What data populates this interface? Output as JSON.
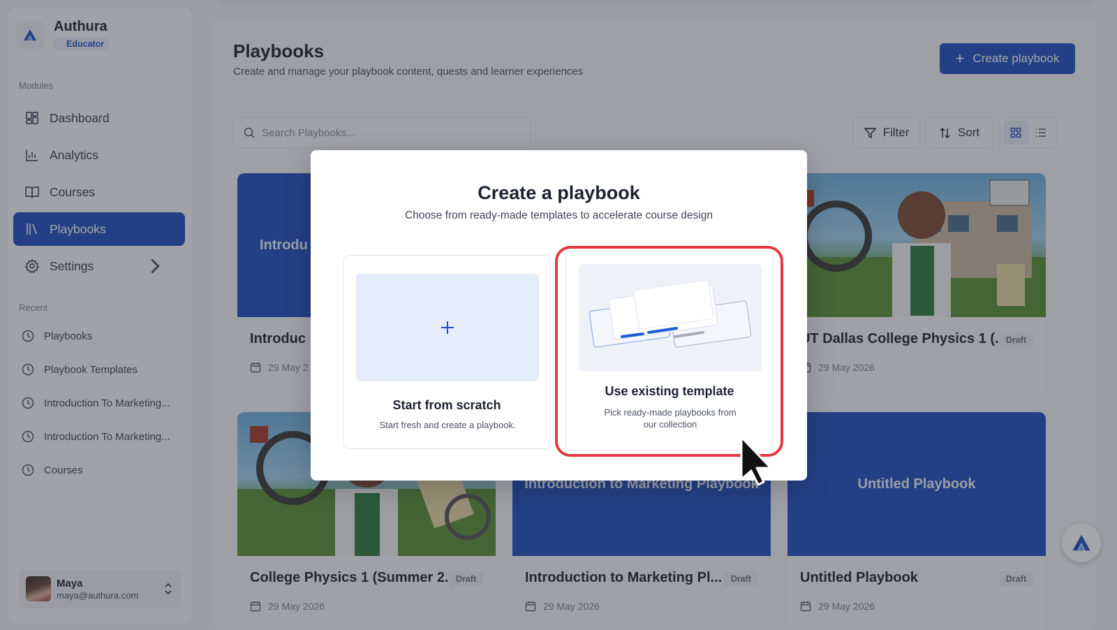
{
  "brand": {
    "name": "Authura",
    "role": "Educator"
  },
  "sidebar": {
    "modules_label": "Modules",
    "items": [
      {
        "label": "Dashboard",
        "icon": "dashboard-icon"
      },
      {
        "label": "Analytics",
        "icon": "bar-chart-icon"
      },
      {
        "label": "Courses",
        "icon": "book-icon"
      },
      {
        "label": "Playbooks",
        "icon": "library-icon",
        "active": true
      },
      {
        "label": "Settings",
        "icon": "gear-icon"
      }
    ],
    "recent_label": "Recent",
    "recent": [
      {
        "label": "Playbooks"
      },
      {
        "label": "Playbook Templates"
      },
      {
        "label": "Introduction To Marketing..."
      },
      {
        "label": "Introduction To Marketing..."
      },
      {
        "label": "Courses"
      }
    ]
  },
  "user": {
    "name": "Maya",
    "email": "maya@authura.com"
  },
  "header": {
    "title": "Playbooks",
    "subtitle": "Create and manage your playbook content, quests and learner experiences",
    "create_label": "Create playbook"
  },
  "toolbar": {
    "search_placeholder": "Search Playbooks...",
    "filter_label": "Filter",
    "sort_label": "Sort"
  },
  "cards": [
    {
      "image_text": "Introdu",
      "title": "Introduc",
      "date": "29 May 2",
      "badge": ""
    },
    {
      "image_text": "",
      "title": "UT Dallas College Physics 1 (...",
      "date": "29 May 2026",
      "badge": "Draft"
    },
    {
      "image_text": "",
      "title": "College Physics 1 (Summer 2...",
      "date": "29 May 2026",
      "badge": "Draft"
    },
    {
      "image_text": "Introduction to Marketing Playbook",
      "title": "Introduction to Marketing Pl...",
      "date": "29 May 2026",
      "badge": "Draft"
    },
    {
      "image_text": "Untitled Playbook",
      "title": "Untitled Playbook",
      "date": "29 May 2026",
      "badge": "Draft"
    }
  ],
  "modal": {
    "title": "Create a playbook",
    "subtitle": "Choose from ready-made templates to accelerate course design",
    "options": [
      {
        "title": "Start from scratch",
        "desc": "Start fresh and create a playbook."
      },
      {
        "title": "Use existing template",
        "desc": "Pick ready-made playbooks from our collection"
      }
    ]
  },
  "colors": {
    "accent": "#1f4fbf",
    "highlight": "#e5393f"
  }
}
